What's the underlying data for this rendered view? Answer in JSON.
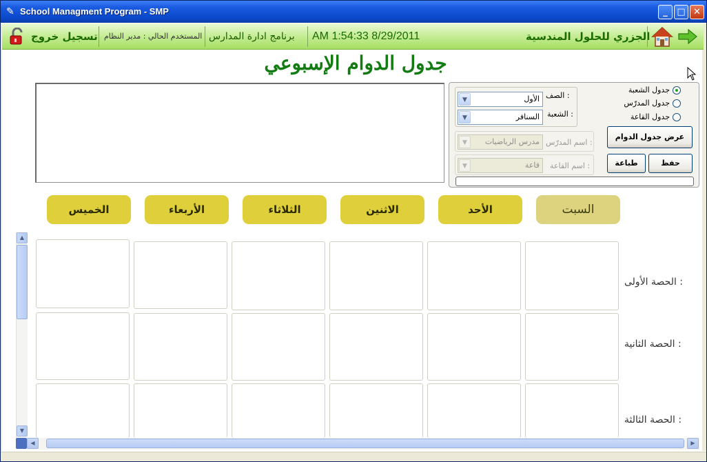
{
  "window": {
    "title": "School Managment Program - SMP",
    "minimize_label": "_",
    "maximize_label": "□",
    "close_label": "✕"
  },
  "header": {
    "logout_label": "تسجيل خروج",
    "current_user_label": "المستخدم الحالي : مدير النظام",
    "program_name": "برنامج ادارة المدارس",
    "datetime": "AM 1:54:33 8/29/2011",
    "company": "الجزري للحلول المندسية",
    "icons": [
      "lock-icon",
      "home-icon",
      "arrow-right-icon"
    ]
  },
  "page_title": "جدول الدوام الإسبوعي",
  "panel": {
    "radios": [
      {
        "label": "جدول الشعبة",
        "checked": true
      },
      {
        "label": "جدول المدرّس",
        "checked": false
      },
      {
        "label": "جدول القاعة",
        "checked": false
      }
    ],
    "grade_label": "الصف :",
    "grade_value": "الأول",
    "section_label": "الشعبة :",
    "section_value": "السنافر",
    "teacher_label": "اسم المدرّس :",
    "teacher_value": "مدرس الرياضيات",
    "room_label": "اسم القاعة :",
    "room_value": "قاعة",
    "show_button": "عرض جدول الدوام",
    "save_button": "حفظ",
    "print_button": "طباعة",
    "progress": 0
  },
  "days": [
    "السبت",
    "الأحد",
    "الاثنين",
    "الثلاثاء",
    "الأربعاء",
    "الخميس"
  ],
  "periods": [
    "الحصة الأولى :",
    "الحصة الثانية :",
    "الحصة الثالثة :"
  ],
  "colors": {
    "header_green": "#a6df63",
    "title_green": "#127b12",
    "day_button": "#dfcf3a"
  }
}
